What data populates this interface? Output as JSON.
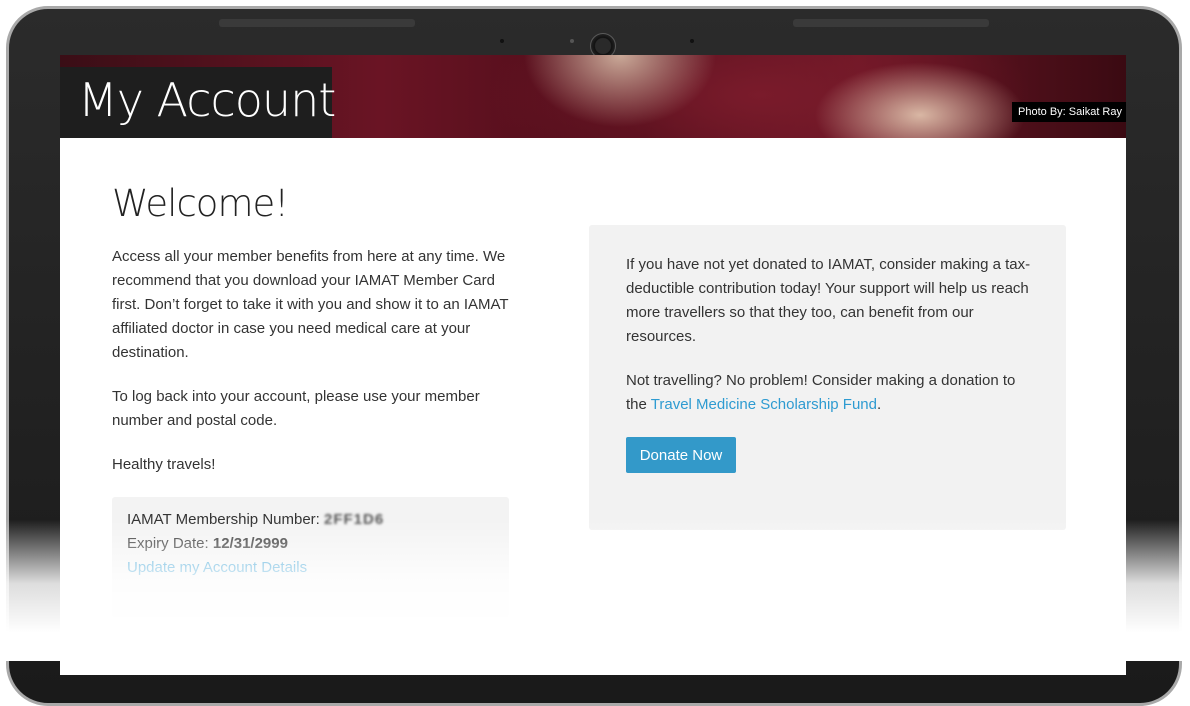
{
  "hero": {
    "title": "My Account",
    "photo_credit": "Photo By: Saikat Ray"
  },
  "main": {
    "heading": "Welcome!",
    "paragraph1": "Access all your member benefits from here at any time. We recommend that you download your IAMAT Member Card first. Don’t forget to take it with you and show it to an IAMAT affiliated doctor in case you need medical care at your destination.",
    "paragraph2": "To log back into your account, please use your member number and postal code.",
    "paragraph3": "Healthy travels!"
  },
  "member": {
    "number_label": "IAMAT Membership Number:",
    "number_value": "2FF1D6",
    "expiry_label": "Expiry Date:",
    "expiry_value": "12/31/2999",
    "update_link": "Update my Account Details"
  },
  "donate": {
    "paragraph1": "If you have not yet donated to IAMAT, consider making a tax-deductible contribution today! Your support will help us reach more travellers so that they too, can benefit from our resources.",
    "paragraph2_before": "Not travelling? No problem! Consider making a donation to the",
    "paragraph2_link": "Travel Medicine Scholarship Fund",
    "paragraph2_after": ".",
    "button_label": "Donate Now"
  },
  "colors": {
    "accent": "#3399c9",
    "link": "#2e9bd1",
    "panel": "#f2f2f2",
    "title_box": "#1e1e1e"
  }
}
